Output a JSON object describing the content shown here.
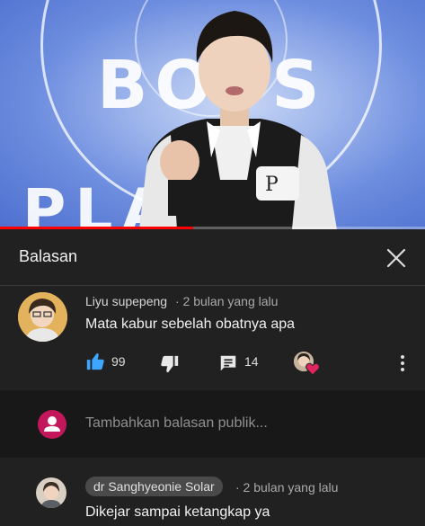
{
  "panel": {
    "title": "Balasan"
  },
  "comment": {
    "author": "Liyu supepeng",
    "time": "· 2 bulan yang lalu",
    "text": "Mata kabur sebelah obatnya apa",
    "likes": "99",
    "replies": "14"
  },
  "reply_input": {
    "placeholder": "Tambahkan balasan publik..."
  },
  "reply": {
    "author": "dr Sanghyeonie Solar",
    "time": "· 2 bulan yang lalu",
    "text": "Dikejar sampai ketangkap ya"
  },
  "video": {
    "logo_line1": "BOYS",
    "logo_line2": "PLANET",
    "progress": 0.455
  },
  "colors": {
    "background": "#212121",
    "accent_like": "#3ea6ff",
    "progress": "#ff0000",
    "heart": "#e0245e"
  },
  "icons": [
    "close-icon",
    "thumbs-up-icon",
    "thumbs-down-icon",
    "comment-icon",
    "heart-icon",
    "more-vert-icon",
    "user-avatar-icon"
  ]
}
